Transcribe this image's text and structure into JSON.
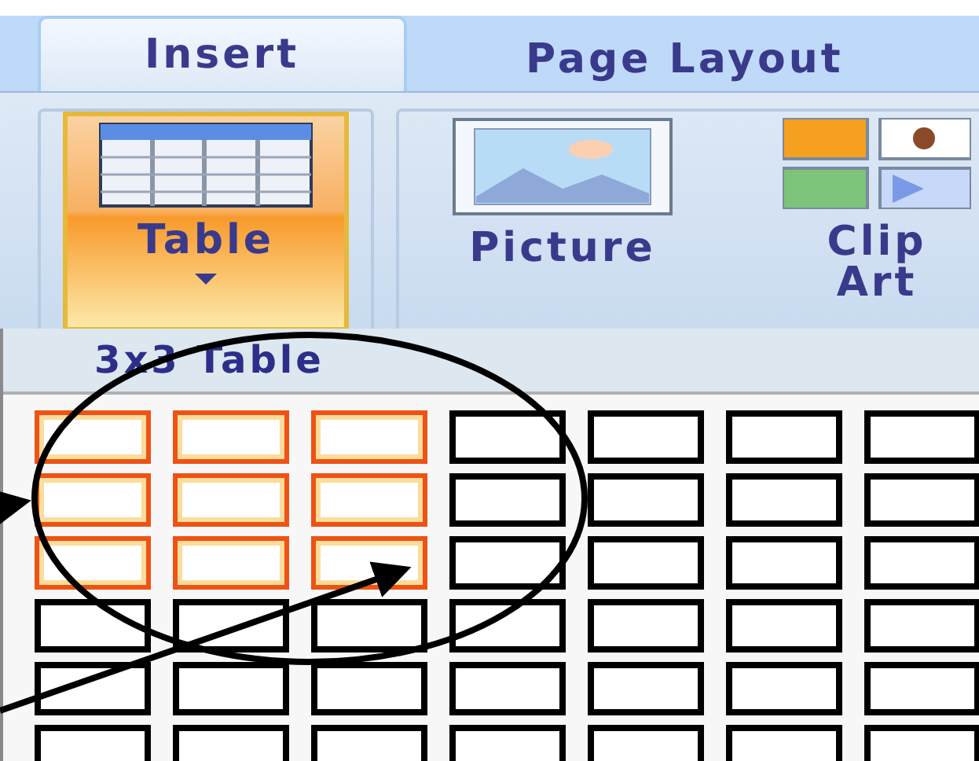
{
  "tabs": [
    {
      "label": "Insert",
      "selected": true
    },
    {
      "label": "Page Layout",
      "selected": false
    }
  ],
  "ribbon": {
    "buttons": [
      {
        "kind": "table",
        "label": "Table",
        "selected": true
      },
      {
        "kind": "picture",
        "label": "Picture",
        "selected": false
      },
      {
        "kind": "clipart",
        "label": "Clip Art",
        "selected": false
      }
    ]
  },
  "table_dropdown": {
    "title": "3x3 Table",
    "rows": [
      {
        "cells": [
          {
            "selected": true
          },
          {
            "selected": true
          },
          {
            "selected": true
          },
          {
            "selected": false
          },
          {
            "selected": false
          },
          {
            "selected": false
          },
          {
            "selected": false
          }
        ]
      },
      {
        "cells": [
          {
            "selected": true
          },
          {
            "selected": true
          },
          {
            "selected": true
          },
          {
            "selected": false
          },
          {
            "selected": false
          },
          {
            "selected": false
          },
          {
            "selected": false
          }
        ]
      },
      {
        "cells": [
          {
            "selected": true
          },
          {
            "selected": true
          },
          {
            "selected": true
          },
          {
            "selected": false
          },
          {
            "selected": false
          },
          {
            "selected": false
          },
          {
            "selected": false
          }
        ]
      },
      {
        "cells": [
          {
            "selected": false
          },
          {
            "selected": false
          },
          {
            "selected": false
          },
          {
            "selected": false
          },
          {
            "selected": false
          },
          {
            "selected": false
          },
          {
            "selected": false
          }
        ]
      },
      {
        "cells": [
          {
            "selected": false
          },
          {
            "selected": false
          },
          {
            "selected": false
          },
          {
            "selected": false
          },
          {
            "selected": false
          },
          {
            "selected": false
          },
          {
            "selected": false
          }
        ]
      },
      {
        "cells": [
          {
            "selected": false
          },
          {
            "selected": false
          },
          {
            "selected": false
          },
          {
            "selected": false
          },
          {
            "selected": false
          },
          {
            "selected": false
          },
          {
            "selected": false
          }
        ]
      }
    ]
  }
}
